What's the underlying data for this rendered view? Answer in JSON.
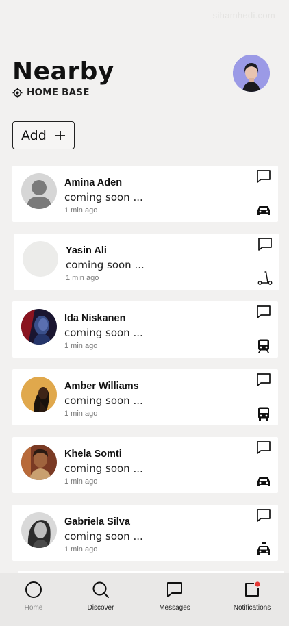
{
  "watermark": "sihamhedi.com",
  "header": {
    "title": "Nearby",
    "location_label": "HOME BASE",
    "location_icon": "crosshair-location-icon",
    "user_avatar": "user-avatar"
  },
  "add_button": {
    "label": "Add",
    "icon": "plus-icon"
  },
  "people": [
    {
      "name": "Amina Aden",
      "status": "coming soon ...",
      "time": "1 min ago",
      "avatar": "placeholder-silhouette",
      "mode_icon": "car-icon"
    },
    {
      "name": "Yasin Ali",
      "status": "coming soon ...",
      "time": "1 min ago",
      "avatar": "placeholder-blank",
      "mode_icon": "scooter-icon"
    },
    {
      "name": "Ida Niskanen",
      "status": "coming soon ...",
      "time": "1 min ago",
      "avatar": "photo",
      "mode_icon": "train-icon"
    },
    {
      "name": "Amber Williams",
      "status": "coming soon ...",
      "time": "1 min ago",
      "avatar": "photo",
      "mode_icon": "bus-icon"
    },
    {
      "name": "Khela Somti",
      "status": "coming soon ...",
      "time": "1 min ago",
      "avatar": "photo",
      "mode_icon": "car-icon"
    },
    {
      "name": "Gabriela Silva",
      "status": "coming soon ...",
      "time": "1 min ago",
      "avatar": "photo",
      "mode_icon": "taxi-icon"
    }
  ],
  "tabbar": {
    "tabs": [
      {
        "label": "Home",
        "icon": "home-circle-icon",
        "active": false
      },
      {
        "label": "Discover",
        "icon": "search-icon",
        "active": true
      },
      {
        "label": "Messages",
        "icon": "message-icon",
        "active": false
      },
      {
        "label": "Notifications",
        "icon": "notification-icon",
        "active": false
      }
    ],
    "notification_dot_color": "#e53935"
  }
}
